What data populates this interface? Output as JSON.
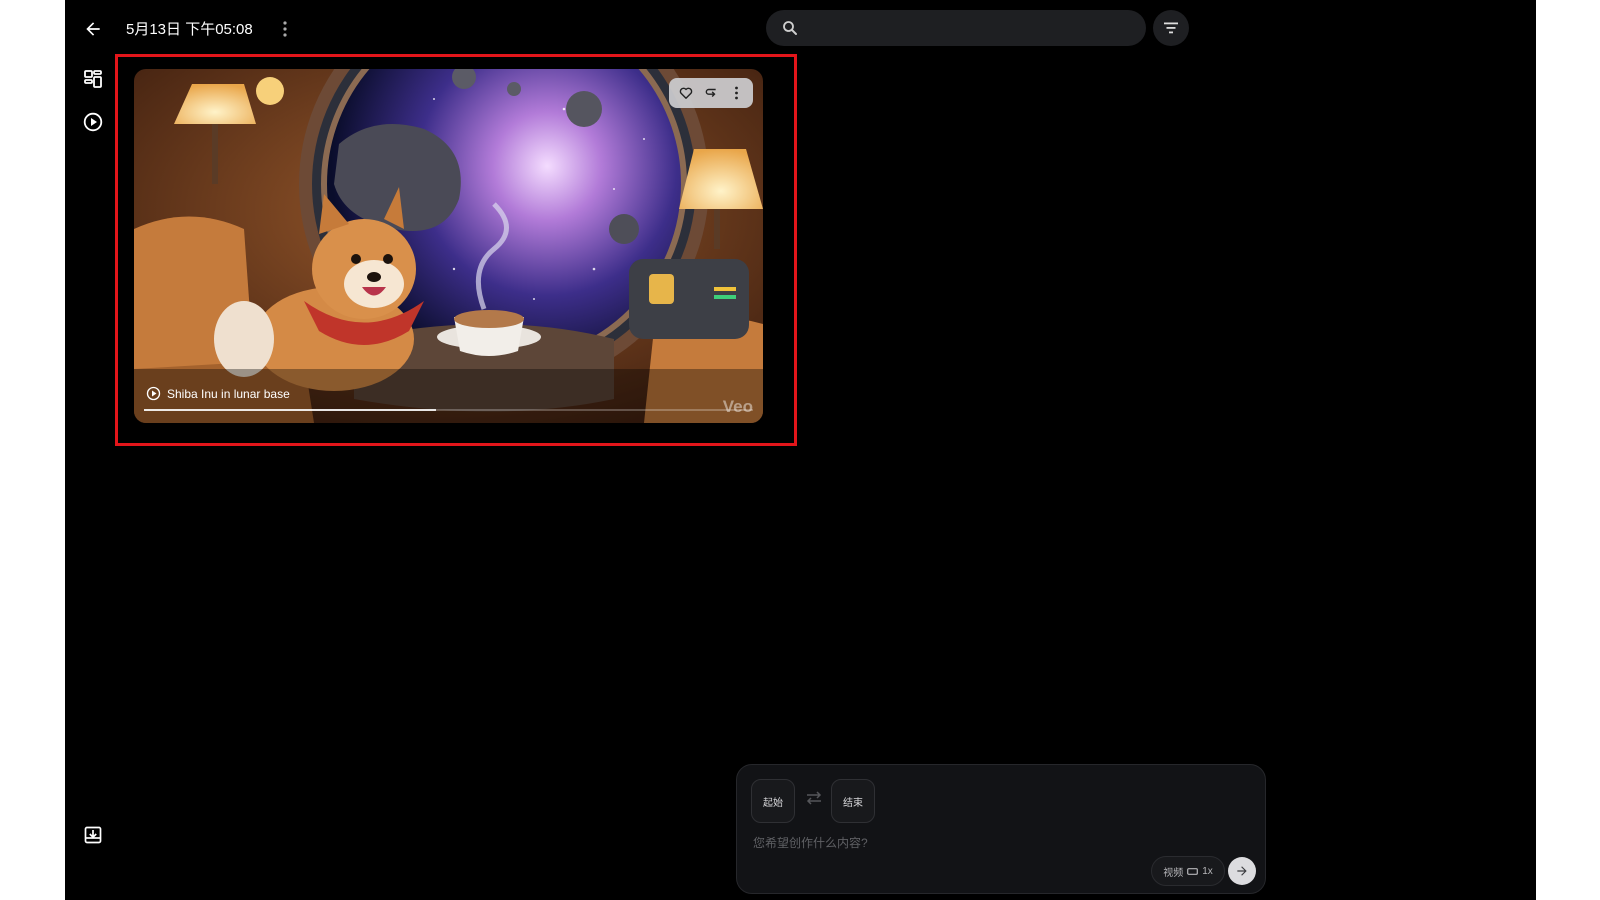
{
  "header": {
    "title": "5月13日 下午05:08",
    "back_icon": "arrow-left-icon",
    "more_icon": "more-vert-icon"
  },
  "search": {
    "placeholder": "",
    "icon": "search-icon"
  },
  "filter": {
    "icon": "filter-icon"
  },
  "rail": {
    "items": [
      {
        "name": "grid-view",
        "icon": "grid-icon"
      },
      {
        "name": "video-view",
        "icon": "play-circle-icon"
      }
    ],
    "bottom_icon": "download-box-icon"
  },
  "card": {
    "caption": "Shiba Inu in lunar base",
    "watermark": "Veo",
    "progress": 0.48,
    "actions": [
      "heart-icon",
      "reuse-prompt-icon",
      "more-vert-icon"
    ]
  },
  "composer": {
    "start_label": "起始",
    "end_label": "结束",
    "placeholder": "您希望创作什么内容?",
    "settings": {
      "mode": "视频",
      "count": "1x"
    },
    "send_icon": "arrow-right-icon"
  },
  "colors": {
    "background": "#000000",
    "highlight": "#e3151a",
    "panel": "#121316"
  }
}
